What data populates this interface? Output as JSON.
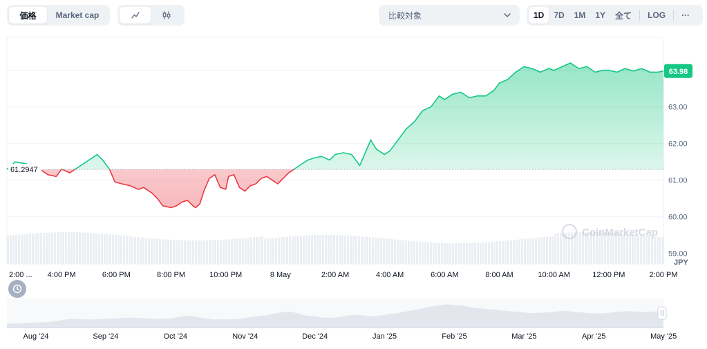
{
  "toolbar": {
    "type_options": [
      "価格",
      "Market cap"
    ],
    "compare_label": "比較対象",
    "ranges": [
      "1D",
      "7D",
      "1M",
      "1Y",
      "全て"
    ],
    "log_label": "LOG",
    "more_label": "···",
    "active_range": "1D",
    "icons": {
      "line": "line-chart-icon",
      "candle": "candlestick-icon",
      "dropdown": "chevron-down-icon",
      "history": "history-icon"
    }
  },
  "colors": {
    "up": "#16c784",
    "down": "#ea3943",
    "up_fill": "#16c784",
    "down_fill": "#ea3943",
    "grid": "#eef0f3",
    "axis_text": "#58667e",
    "volume": "#ebeef2",
    "nav_fill": "#e3e7ed"
  },
  "watermark": "CoinMarketCap",
  "chart_data": {
    "type": "line",
    "currency_label": "JPY",
    "reference_price": 61.2947,
    "reference_label": "61.2947",
    "current_price": 63.98,
    "current_label": "63.98",
    "ylim": [
      58.75,
      64.9
    ],
    "y_ticks": [
      59.0,
      60.0,
      61.0,
      62.0,
      63.0
    ],
    "y_tick_labels": [
      "59.00",
      "60.00",
      "61.00",
      "62.00",
      "63.00"
    ],
    "x_tick_labels": [
      "2:00 ...",
      "4:00 PM",
      "6:00 PM",
      "8:00 PM",
      "10:00 PM",
      "8 May",
      "2:00 AM",
      "4:00 AM",
      "6:00 AM",
      "8:00 AM",
      "10:00 AM",
      "12:00 PM",
      "2:00 PM"
    ],
    "x_tick_hours": [
      0,
      2,
      4,
      6,
      8,
      10,
      12,
      14,
      16,
      18,
      20,
      22,
      24
    ],
    "series": [
      {
        "x_hours": [
          0,
          0.3,
          0.7,
          1.2,
          1.5,
          1.8,
          2.0,
          2.3,
          2.6,
          2.9,
          3.1,
          3.3,
          3.5,
          3.75,
          3.95,
          4.2,
          4.5,
          4.8,
          5.0,
          5.3,
          5.5,
          5.7,
          6.0,
          6.2,
          6.4,
          6.6,
          6.8,
          6.9,
          7.05,
          7.2,
          7.4,
          7.6,
          7.8,
          8.0,
          8.1,
          8.3,
          8.5,
          8.7,
          8.9,
          9.1,
          9.3,
          9.5,
          9.7,
          9.9,
          10.1,
          10.3,
          10.5,
          10.7,
          11.0,
          11.2,
          11.5,
          11.8,
          12.0,
          12.3,
          12.6,
          12.9,
          13.1,
          13.3,
          13.5,
          13.8,
          14.0,
          14.3,
          14.6,
          14.9,
          15.2,
          15.5,
          15.8,
          16.0,
          16.3,
          16.6,
          16.9,
          17.2,
          17.5,
          17.8,
          18.0,
          18.3,
          18.6,
          18.9,
          19.2,
          19.5,
          19.8,
          20.0,
          20.3,
          20.6,
          20.9,
          21.2,
          21.5,
          21.8,
          22.0,
          22.3,
          22.6,
          22.9,
          23.2,
          23.5,
          23.8,
          24.0
        ],
        "values": [
          61.3,
          61.5,
          61.45,
          61.3,
          61.15,
          61.1,
          61.3,
          61.2,
          61.35,
          61.5,
          61.6,
          61.7,
          61.55,
          61.3,
          60.95,
          60.9,
          60.85,
          60.75,
          60.8,
          60.65,
          60.5,
          60.3,
          60.25,
          60.3,
          60.4,
          60.45,
          60.3,
          60.25,
          60.35,
          60.7,
          61.05,
          61.15,
          60.8,
          60.75,
          61.1,
          61.15,
          60.8,
          60.7,
          60.85,
          60.9,
          61.05,
          61.1,
          61.0,
          60.9,
          61.05,
          61.2,
          61.3,
          61.4,
          61.55,
          61.6,
          61.65,
          61.55,
          61.7,
          61.75,
          61.7,
          61.4,
          61.75,
          62.1,
          61.85,
          61.7,
          61.8,
          62.1,
          62.4,
          62.6,
          62.9,
          63.0,
          63.3,
          63.2,
          63.35,
          63.4,
          63.25,
          63.3,
          63.3,
          63.45,
          63.65,
          63.75,
          63.95,
          64.1,
          64.05,
          63.95,
          64.05,
          64.0,
          64.1,
          64.2,
          64.05,
          64.1,
          63.95,
          64.0,
          64.0,
          63.95,
          64.05,
          63.98,
          64.05,
          63.95,
          63.95,
          63.98
        ]
      }
    ],
    "navigator": {
      "x_tick_labels": [
        "Aug '24",
        "Sep '24",
        "Oct '24",
        "Nov '24",
        "Dec '24",
        "Jan '25",
        "Feb '25",
        "Mar '25",
        "Apr '25",
        "May '25"
      ],
      "values": [
        10,
        10,
        11,
        12,
        13,
        14,
        16,
        20,
        22,
        21,
        20,
        21,
        22,
        23,
        24,
        25,
        24,
        23,
        22,
        22,
        24,
        28,
        30,
        26,
        22,
        20,
        21,
        20,
        22,
        25,
        28,
        30,
        34,
        38,
        40,
        36,
        30,
        28,
        25,
        24,
        26,
        30,
        32,
        30,
        28,
        30,
        34,
        36,
        40,
        44,
        48,
        52,
        56,
        58,
        56,
        54,
        50,
        48,
        46,
        44,
        42,
        40,
        38,
        36,
        37,
        38,
        40,
        42,
        40,
        38,
        36,
        35,
        36,
        38,
        40,
        41,
        40,
        39,
        40,
        42
      ]
    }
  }
}
